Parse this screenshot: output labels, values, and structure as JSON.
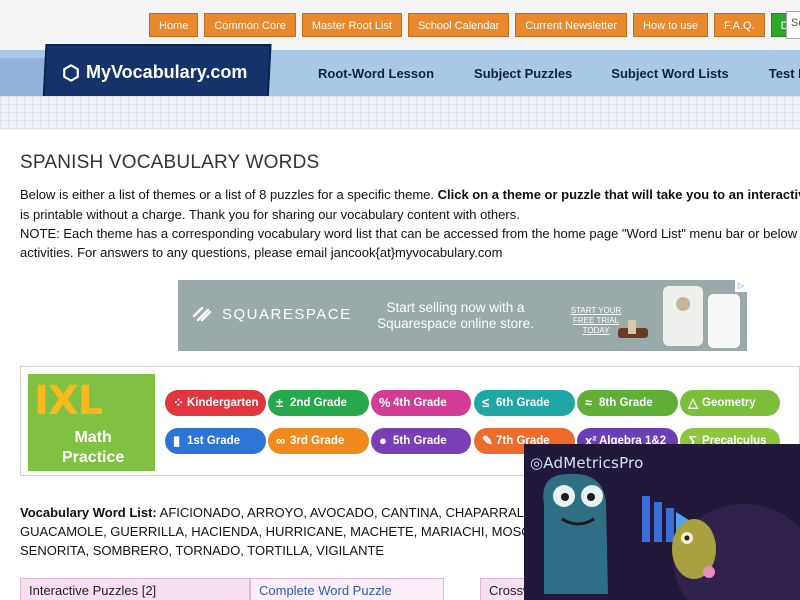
{
  "topnav": {
    "items": [
      "Home",
      "Common Core",
      "Master Root List",
      "School Calendar",
      "Current Newsletter",
      "How to use",
      "F.A.Q."
    ],
    "donate": "Donate",
    "search_placeholder": "Se"
  },
  "header": {
    "logo": "MyVocabulary.com",
    "nav": [
      "Root-Word Lesson",
      "Subject Puzzles",
      "Subject Word Lists",
      "Test Pre"
    ]
  },
  "main": {
    "title": "SPANISH VOCABULARY WORDS",
    "intro_line1_plain": "Below is either a list of themes or a list of 8 puzzles for a specific theme. ",
    "intro_line1_bold": "Click on a theme or puzzle that will take you to an interactive ac",
    "intro_line2": "is printable without a charge. Thank you for sharing our vocabulary content with others.",
    "note_line1": "NOTE: Each theme has a corresponding vocabulary word list that can be accessed from the home page \"Word List\" menu bar or below the se",
    "note_line2": "activities. For answers to any questions, please email jancook{at}myvocabulary.com"
  },
  "ad_squarespace": {
    "brand": "SQUARESPACE",
    "message": "Start selling now with a Squarespace online store.",
    "cta": "START YOUR FREE TRIAL TODAY",
    "adchoice": "▷"
  },
  "ad_ixl": {
    "logo": "IXL",
    "subtitle_line1": "Math",
    "subtitle_line2": "Practice",
    "grades": [
      {
        "label": "Kindergarten",
        "icon": "⁘",
        "color": "#e2363f"
      },
      {
        "label": "2nd Grade",
        "icon": "±",
        "color": "#27a84a"
      },
      {
        "label": "4th Grade",
        "icon": "%",
        "color": "#d23c97"
      },
      {
        "label": "6th Grade",
        "icon": "≤",
        "color": "#1fa6a6"
      },
      {
        "label": "8th Grade",
        "icon": "≈",
        "color": "#5fae36"
      },
      {
        "label": "Geometry",
        "icon": "△",
        "color": "#7cbf3a"
      },
      {
        "label": "1st Grade",
        "icon": "▮",
        "color": "#2c74d6"
      },
      {
        "label": "3rd Grade",
        "icon": "∞",
        "color": "#f08a1c"
      },
      {
        "label": "5th Grade",
        "icon": "●",
        "color": "#7a3fb6"
      },
      {
        "label": "7th Grade",
        "icon": "✎",
        "color": "#ef6b2c"
      },
      {
        "label": "Algebra 1&2",
        "icon": "x²",
        "color": "#6a3fb8"
      },
      {
        "label": "Precalculus",
        "icon": "∑",
        "color": "#8cc63f"
      }
    ]
  },
  "vocab": {
    "label": "Vocabulary Word List:",
    "line1": " AFICIONADO, ARROYO, AVOCADO, CANTINA, CHAPARRAL, C",
    "line2": "GUACAMOLE, GUERRILLA, HACIENDA, HURRICANE, MACHETE, MARIACHI, MOSQUI",
    "line3": "SENORITA, SOMBRERO, TORNADO, TORTILLA, VIGILANTE"
  },
  "table": {
    "col1": "Interactive Puzzles [2]",
    "col2": "Complete Word Puzzle",
    "col3": "Crossw"
  },
  "video_ad": {
    "brand": "AdMetricsPro"
  }
}
